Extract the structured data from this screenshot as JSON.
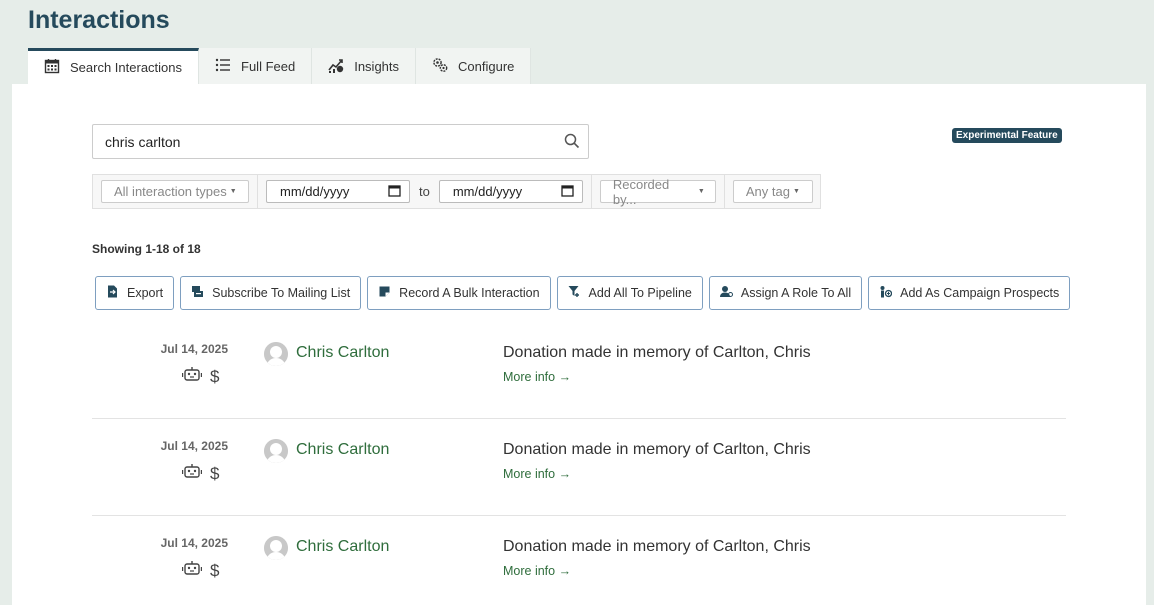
{
  "page": {
    "title": "Interactions"
  },
  "tabs": [
    {
      "label": "Search Interactions",
      "icon": "calendar-icon",
      "active": true
    },
    {
      "label": "Full Feed",
      "icon": "list-icon",
      "active": false
    },
    {
      "label": "Insights",
      "icon": "chart-icon",
      "active": false
    },
    {
      "label": "Configure",
      "icon": "gears-icon",
      "active": false
    }
  ],
  "search": {
    "value": "chris carlton",
    "icon": "search-icon"
  },
  "badge": "Experimental Feature",
  "filters": {
    "type": "All interaction types",
    "date_from": "mm/dd/yyyy",
    "to_label": "to",
    "date_to": "mm/dd/yyyy",
    "recorded_by": "Recorded by...",
    "tag": "Any tag"
  },
  "showing": "Showing 1-18 of 18",
  "actions": [
    {
      "label": "Export",
      "icon": "file-export-icon"
    },
    {
      "label": "Subscribe To Mailing List",
      "icon": "mailing-list-icon"
    },
    {
      "label": "Record A Bulk Interaction",
      "icon": "note-icon"
    },
    {
      "label": "Add All To Pipeline",
      "icon": "filter-add-icon"
    },
    {
      "label": "Assign A Role To All",
      "icon": "user-role-icon"
    },
    {
      "label": "Add As Campaign Prospects",
      "icon": "campaign-prospect-icon"
    }
  ],
  "rows": [
    {
      "date": "Jul 14, 2025",
      "name": "Chris Carlton",
      "description": "Donation made in memory of Carlton, Chris",
      "more": "More info →"
    },
    {
      "date": "Jul 14, 2025",
      "name": "Chris Carlton",
      "description": "Donation made in memory of Carlton, Chris",
      "more": "More info →"
    },
    {
      "date": "Jul 14, 2025",
      "name": "Chris Carlton",
      "description": "Donation made in memory of Carlton, Chris",
      "more": "More info →"
    }
  ],
  "colors": {
    "brand": "#254a5c",
    "link": "#2f6d3c",
    "background": "#e6ede9"
  }
}
